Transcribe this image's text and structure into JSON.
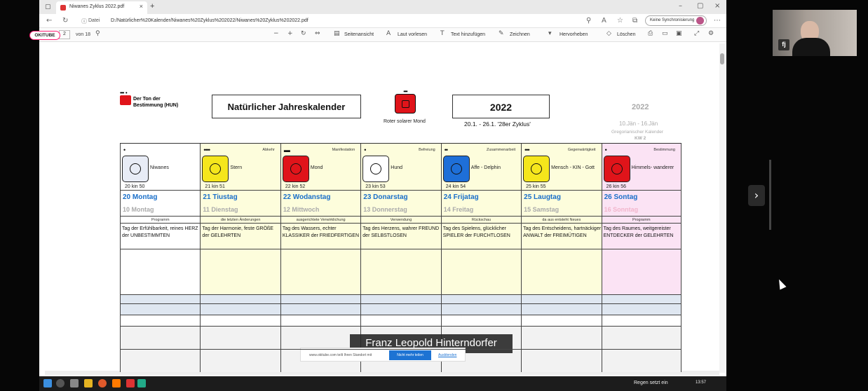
{
  "browser": {
    "tab_title": "Niwanes Zyklus 2022.pdf",
    "address_label": "Datei",
    "url": "D:/Natürlicher%20Kalender/Niwanes%20Zyklus%202022/Niwanes%20Zyklus%202022.pdf",
    "sync_label": "Keine Synchronisierung"
  },
  "pdf_toolbar": {
    "page": "2",
    "of": "von 18",
    "page_view": "Seitenansicht",
    "read_aloud": "Laut vorlesen",
    "add_text": "Text hinzufügen",
    "draw": "Zeichnen",
    "highlight": "Hervorheben",
    "erase": "Löschen"
  },
  "okitube": "OKITUBE",
  "header": {
    "tone_label_1": "Der Ton der",
    "tone_label_2": "Bestimmung (HUN)",
    "title": "Natürlicher Jahreskalender",
    "moon_label": "Roter solarer Mond",
    "year": "2022",
    "range": "20.1. - 26.1.  '28er Zyklus'",
    "greg_year": "2022",
    "greg_range": "10.Jän - 16.Jän",
    "greg_label": "Gregorianischer Kalender",
    "kw": "KW 2"
  },
  "days": [
    {
      "role": "",
      "tone": "Niwanes",
      "kin": "20 kin 50",
      "day": "20 Montag",
      "greg": "10 Montag",
      "label": "Programm",
      "desc": "Tag der Erfühlbarkeit, reines HERZ der UNBESTIMMTEN",
      "color": "#ffffff",
      "sym_color": "#e8ecf6",
      "dots": "•"
    },
    {
      "role": "Abkehr",
      "tone": "Stern",
      "kin": "21 kin 51",
      "day": "21 Tiustag",
      "greg": "11 Dienstag",
      "label": "die letzten Änderungen",
      "desc": "Tag der Harmonie, feste GRÖßE der GELEHRTEN",
      "color": "#fdfddc",
      "sym_color": "#f5e61c",
      "dots": "••••"
    },
    {
      "role": "Manifestation",
      "tone": "Mond",
      "kin": "22 kin 52",
      "day": "22 Wodanstag",
      "greg": "12 Mittwoch",
      "label": "ausgerichtete Verwirklichung",
      "desc": "Tag des Wassers, echter KLASSIKER der FRIEDFERTIGEN",
      "color": "#fdfddc",
      "sym_color": "#e0141a",
      "dots": "▬"
    },
    {
      "role": "Befreiung",
      "tone": "Hund",
      "kin": "23 kin 53",
      "day": "23 Donarstag",
      "greg": "13 Donnerstag",
      "label": "Verwendung",
      "desc": "Tag des Herzens, wahrer FREUND der SELBSTLOSEN",
      "color": "#fdfddc",
      "sym_color": "#ffffff",
      "dots": "•"
    },
    {
      "role": "Zusammenarbeit",
      "tone": "Affe - Delphin",
      "kin": "24 kin 54",
      "day": "24 Frijatag",
      "greg": "14 Freitag",
      "label": "Rückschau",
      "desc": "Tag des Spielens, glücklicher SPIELER der FURCHTLOSEN",
      "color": "#fdfddc",
      "sym_color": "#1e6fd8",
      "dots": "••"
    },
    {
      "role": "Gegenwärtigkeit",
      "tone": "Mensch - KIN - Gott",
      "kin": "25 kin 55",
      "day": "25 Laugtag",
      "greg": "15 Samstag",
      "label": "da aus entsteht Neues",
      "desc": "Tag des Entscheidens, hartnäckiger ANWALT der FREIMÜTIGEN",
      "color": "#fdfddc",
      "sym_color": "#f5e61c",
      "dots": "•••"
    },
    {
      "role": "Bestimmung",
      "tone": "Himmels- wanderer",
      "kin": "26 kin 56",
      "day": "26 Sontag",
      "greg": "16 Sonntag",
      "label": "Programm",
      "desc": "Tag des Raumes, weitgereister ENTDECKER der GELEHRTEN",
      "color": "#fbe3f4",
      "sym_color": "#e0141a",
      "dots": "•"
    }
  ],
  "caption": "Franz Leopold Hinterndorfer",
  "cookie": {
    "text": "www.okitube.com teilt Ihren Standort mit",
    "button": "Nicht mehr teilen",
    "link": "Ausblenden"
  },
  "taskbar": {
    "tray_text": "Regen setzt ein",
    "clock": "13:57"
  },
  "webcam": {
    "initials": "fj"
  },
  "colors": {
    "accent_blue": "#1a6fc9",
    "okitube_pink": "#ff2277"
  }
}
